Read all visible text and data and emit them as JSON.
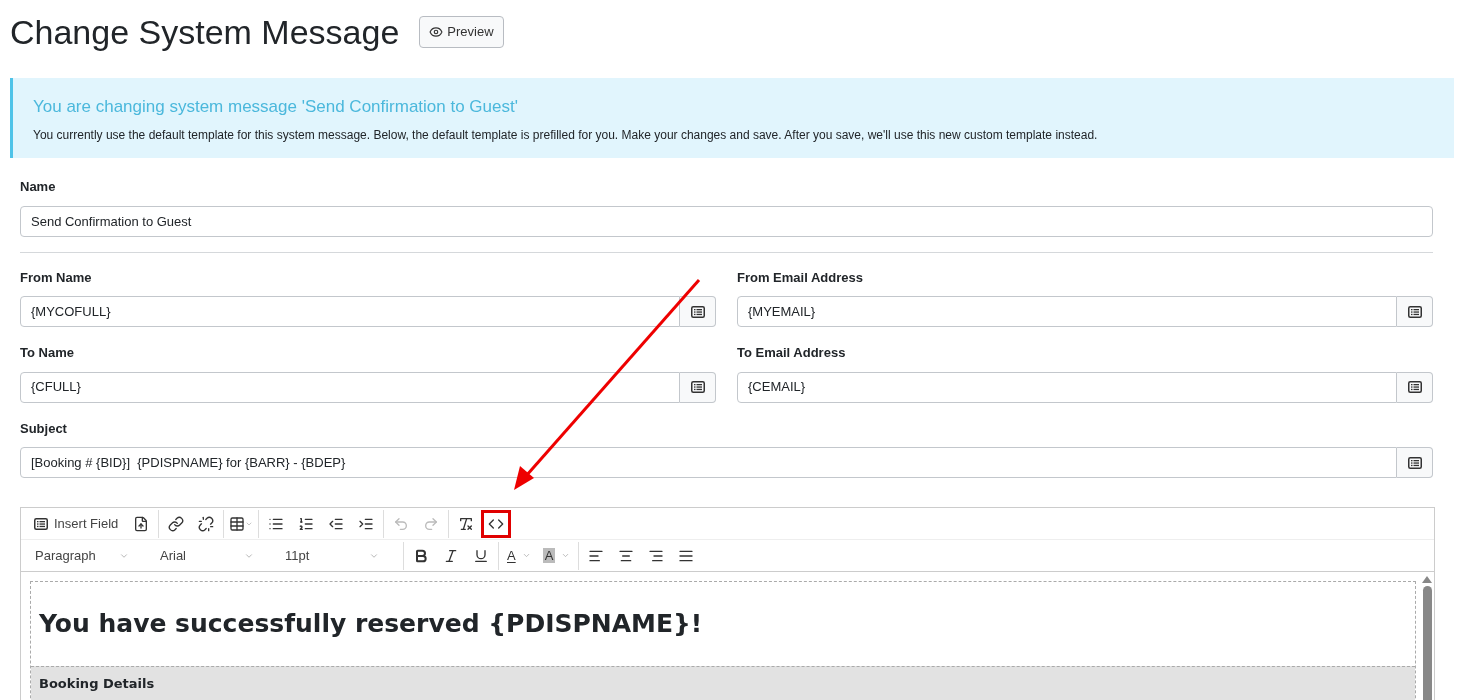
{
  "title": "Change System Message",
  "preview_button": "Preview",
  "alert": {
    "heading": "You are changing system message 'Send Confirmation to Guest'",
    "body": "You currently use the default template for this system message. Below, the default template is prefilled for you. Make your changes and save. After you save, we'll use this new custom template instead."
  },
  "fields": [
    {
      "label": "Name",
      "value": "Send Confirmation to Guest",
      "kind": "plain"
    },
    {
      "label": "From Name",
      "value": "{MYCOFULL}",
      "kind": "insert"
    },
    {
      "label": "From Email Address",
      "value": "{MYEMAIL}",
      "kind": "insert"
    },
    {
      "label": "To Name",
      "value": "{CFULL}",
      "kind": "insert"
    },
    {
      "label": "To Email Address",
      "value": "{CEMAIL}",
      "kind": "insert"
    },
    {
      "label": "Subject",
      "value": "[Booking # {BID}]  {PDISPNAME} for {BARR} - {BDEP}",
      "kind": "insert"
    }
  ],
  "editor": {
    "toolbar_rows": [
      [
        [
          {
            "kind": "insert-field",
            "label": "Insert Field"
          },
          {
            "kind": "upload"
          }
        ],
        [
          {
            "kind": "link"
          },
          {
            "kind": "unlink"
          }
        ],
        [
          {
            "kind": "table"
          }
        ],
        [
          {
            "kind": "bullets"
          },
          {
            "kind": "numbers"
          },
          {
            "kind": "outdent"
          },
          {
            "kind": "indent"
          }
        ],
        [
          {
            "kind": "undo",
            "disabled": true
          },
          {
            "kind": "redo",
            "disabled": true
          }
        ],
        [
          {
            "kind": "clear-format"
          },
          {
            "kind": "source-code",
            "highlighted": true
          }
        ]
      ],
      [
        [
          {
            "kind": "select",
            "value": "Paragraph"
          },
          {
            "kind": "select",
            "value": "Arial"
          },
          {
            "kind": "select",
            "value": "11pt"
          }
        ],
        [
          {
            "kind": "bold"
          },
          {
            "kind": "italic"
          },
          {
            "kind": "underline"
          }
        ],
        [
          {
            "kind": "color",
            "glyph": "A"
          },
          {
            "kind": "bg-color",
            "glyph": "A"
          }
        ],
        [
          {
            "kind": "align-left"
          },
          {
            "kind": "align-center"
          },
          {
            "kind": "align-right"
          },
          {
            "kind": "align-justify"
          }
        ]
      ]
    ],
    "content": {
      "heading": "You have successfully reserved {PDISPNAME}!",
      "section": "Booking Details"
    }
  },
  "annotation": {
    "kind": "arrow"
  }
}
